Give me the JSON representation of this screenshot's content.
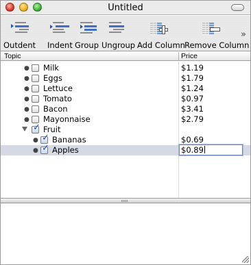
{
  "window": {
    "title": "Untitled"
  },
  "toolbar": {
    "items": [
      {
        "label": "Outdent",
        "icon": "outdent-icon"
      },
      {
        "label": "Indent",
        "icon": "indent-icon"
      },
      {
        "label": "Group",
        "icon": "group-icon"
      },
      {
        "label": "Ungroup",
        "icon": "ungroup-icon"
      },
      {
        "label": "Add Column",
        "icon": "add-column-icon"
      },
      {
        "label": "Remove Column",
        "icon": "remove-column-icon"
      }
    ],
    "overflow": "»"
  },
  "columns": {
    "topic": "Topic",
    "price": "Price"
  },
  "rows": [
    {
      "topic": "Milk",
      "price": "$1.19",
      "checked": false,
      "level": 0
    },
    {
      "topic": "Eggs",
      "price": "$1.79",
      "checked": false,
      "level": 0
    },
    {
      "topic": "Lettuce",
      "price": "$1.24",
      "checked": false,
      "level": 0
    },
    {
      "topic": "Tomato",
      "price": "$0.97",
      "checked": false,
      "level": 0
    },
    {
      "topic": "Bacon",
      "price": "$3.41",
      "checked": false,
      "level": 0
    },
    {
      "topic": "Mayonnaise",
      "price": "$2.79",
      "checked": false,
      "level": 0
    },
    {
      "topic": "Fruit",
      "price": "",
      "checked": true,
      "level": 0,
      "expanded": true
    },
    {
      "topic": "Bananas",
      "price": "$0.69",
      "checked": true,
      "level": 1
    },
    {
      "topic": "Apples",
      "price": "$0.89",
      "checked": true,
      "level": 1,
      "selected": true,
      "editing": true
    }
  ],
  "colors": {
    "selection": "#d4d9e3",
    "check": "#1c4fb8",
    "accent": "#3f6fc9"
  }
}
